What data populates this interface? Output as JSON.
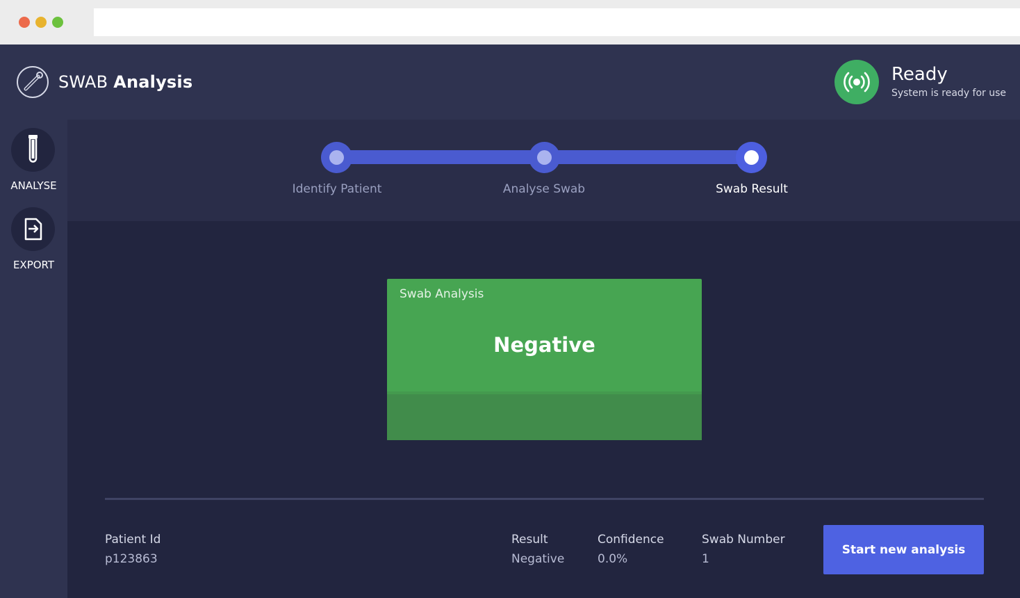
{
  "app": {
    "title_light": "SWAB",
    "title_bold": "Analysis"
  },
  "status": {
    "title": "Ready",
    "subtitle": "System is ready for use",
    "color": "#3fae63",
    "icon": "broadcast-icon"
  },
  "sidebar": {
    "items": [
      {
        "label": "ANALYSE",
        "icon": "test-tube-icon"
      },
      {
        "label": "EXPORT",
        "icon": "export-icon"
      }
    ]
  },
  "stepper": {
    "steps": [
      {
        "label": "Identify Patient",
        "state": "done"
      },
      {
        "label": "Analyse Swab",
        "state": "done"
      },
      {
        "label": "Swab Result",
        "state": "active"
      }
    ]
  },
  "result_card": {
    "title": "Swab Analysis",
    "result": "Negative",
    "color": "#47a552"
  },
  "summary": {
    "patient_id_label": "Patient Id",
    "patient_id_value": "p123863",
    "result_label": "Result",
    "result_value": "Negative",
    "confidence_label": "Confidence",
    "confidence_value": "0.0%",
    "swab_number_label": "Swab Number",
    "swab_number_value": "1"
  },
  "actions": {
    "start_new_label": "Start new analysis"
  },
  "colors": {
    "accent": "#4e62e2",
    "background": "#22253f",
    "header": "#2f3350"
  }
}
